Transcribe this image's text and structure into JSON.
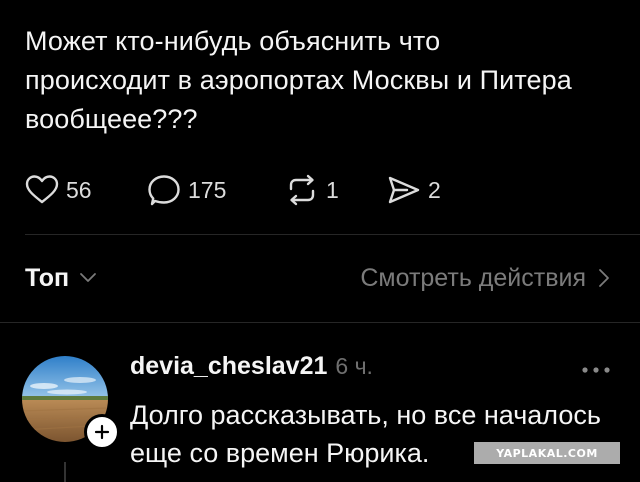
{
  "post": {
    "text": "Может кто-нибудь объяснить что происходит в аэропортах Москвы и Питера вообщеее???",
    "likes": "56",
    "comments": "175",
    "reposts": "1",
    "shares": "2"
  },
  "sort": {
    "label": "Топ",
    "view_activity_label": "Смотреть действия"
  },
  "comment": {
    "username": "devia_cheslav21",
    "time": "6 ч.",
    "text": "Долго рассказывать, но все началось еще со времен Рюрика."
  },
  "watermark": "YAPLAKAL.COM",
  "icons": {
    "like": "heart-icon",
    "comment": "comment-bubble-icon",
    "repost": "repost-icon",
    "share": "share-send-icon",
    "sort_chevron": "chevron-down-icon",
    "view_chevron": "chevron-right-icon",
    "more": "more-horizontal-icon",
    "follow": "plus-icon"
  },
  "colors": {
    "background": "#000000",
    "text_primary": "#f5f5f5",
    "text_secondary": "#7b7b7b",
    "divider": "#262626"
  }
}
